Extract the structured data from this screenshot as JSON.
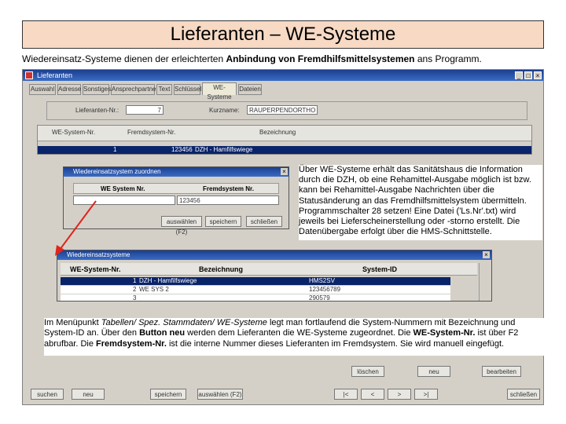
{
  "slide": {
    "title": "Lieferanten – WE-Systeme",
    "intro_prefix": "Wiedereinsatz-Systeme dienen der erleichterten ",
    "intro_bold": "Anbindung von Fremdhilfsmittelsystemen",
    "intro_suffix": " ans Programm."
  },
  "window": {
    "title": "Lieferanten",
    "tabs": [
      "Auswahl",
      "Adresse",
      "Sonstiges",
      "Ansprechpartner",
      "Text",
      "Schlüssel",
      "WE-Systeme",
      "Dateien"
    ],
    "active_tab": "WE-Systeme",
    "supplier_no_label": "Lieferanten-Nr.:",
    "supplier_no_value": "7",
    "shortname_label": "Kurzname:",
    "shortname_value": "RAUPERPENDORTHO",
    "grid_headers": [
      "WE-System-Nr.",
      "Fremdsystem-Nr.",
      "Bezeichnung"
    ],
    "grid_row": {
      "nr": "1",
      "fremd": "123456",
      "bez": "DZH - Hamfilfswiege"
    },
    "buttons_bottom": [
      "suchen",
      "neu",
      "speichern",
      "auswählen (F2)",
      "|<",
      "<",
      ">",
      ">|",
      "löschen",
      "neu",
      "bearbeiten",
      "schließen"
    ]
  },
  "dialog_assign": {
    "title": "Wiedereinsatzsystem zuordnen",
    "col1": "WE System Nr.",
    "col2": "Fremdsystem Nr.",
    "val2": "123456",
    "buttons": [
      "auswählen (F2)",
      "speichern",
      "schließen"
    ]
  },
  "dialog_systems": {
    "title": "Wiedereinsatzsysteme",
    "col1": "WE-System-Nr.",
    "col2": "Bezeichnung",
    "col3": "System-ID",
    "rows": [
      {
        "nr": "1",
        "bez": "DZH - Hamfilfswiege",
        "id": "HMS2SV"
      },
      {
        "nr": "2",
        "bez": "WE SYS 2",
        "id": "123456789"
      },
      {
        "nr": "3",
        "bez": "",
        "id": "290579"
      }
    ]
  },
  "info_right": "Über WE-Systeme erhält das Sanitätshaus die Information durch die DZH, ob eine Rehamittel-Ausgabe möglich ist bzw. kann bei Rehamittel-Ausgabe Nachrichten über die Statusänderung an das Fremdhilfsmittelsystem übermitteln. Programmschalter 28 setzen! Eine Datei ('Ls.Nr'.txt) wird jeweils bei Lieferscheinerstellung oder -storno erstellt. Die Datenübergabe erfolgt über die HMS-Schnittstelle.",
  "info_bottom": {
    "p1": "Im Menüpunkt ",
    "p1_italic": "Tabellen/ Spez. Stammdaten/ WE-Systeme",
    "p2": " legt man fortlaufend die System-Nummern mit Bezeichnung und System-ID an. Über den ",
    "p2_bold": "Button neu",
    "p3": " werden dem Lieferanten die WE-Systeme zugeordnet. Die ",
    "p3_bold": "WE-System-Nr.",
    "p4": " ist über F2 abrufbar. Die ",
    "p4_bold": "Fremdsystem-Nr.",
    "p5": " ist die interne Nummer dieses Lieferanten im Fremdsystem. Sie wird manuell eingefügt."
  },
  "colors": {
    "title_bg": "#f7d9c4",
    "selection": "#0a246a",
    "arrow": "#e0241b"
  }
}
